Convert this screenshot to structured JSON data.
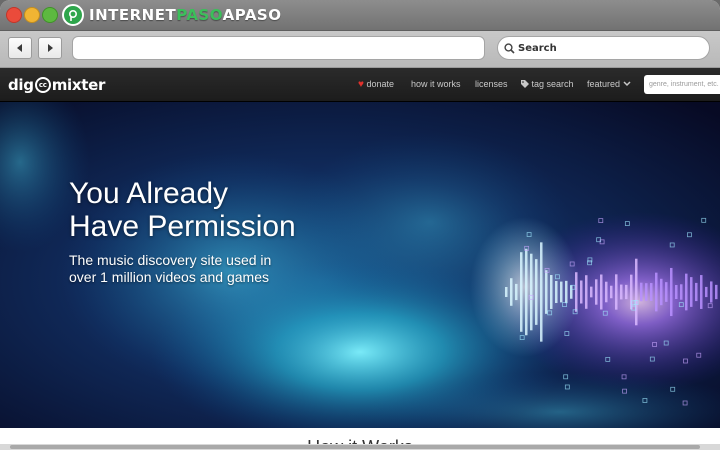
{
  "window": {
    "brand_prefix": "INTERNET",
    "brand_highlight": "PASO",
    "brand_suffix": "APASO"
  },
  "toolbar": {
    "back_icon": "back-arrow-icon",
    "forward_icon": "forward-arrow-icon",
    "url_value": "",
    "search_label": "Search"
  },
  "site": {
    "logo_prefix": "dig",
    "logo_cc": "cc",
    "logo_suffix": "mixter",
    "nav": {
      "donate": "donate",
      "how_it_works": "how it works",
      "licenses": "licenses",
      "tag_search": "tag search",
      "featured": "featured"
    },
    "search_placeholder": "genre, instrument, etc."
  },
  "hero": {
    "title_line1": "You Already",
    "title_line2": "Have Permission",
    "subtitle_line1": "The music discovery site used in",
    "subtitle_line2": "over 1 million videos and games"
  },
  "below": {
    "heading": "How it Works"
  },
  "colors": {
    "accent_green": "#2fa64c",
    "heart_red": "#e2312c",
    "site_bar": "#1f1f1f",
    "hero_cyan": "#3fd4e8",
    "hero_purple": "#8a3dff"
  }
}
